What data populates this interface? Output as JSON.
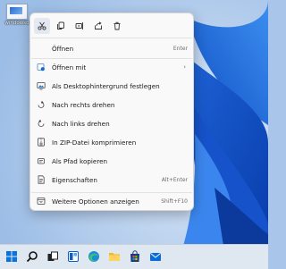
{
  "desktop": {
    "icon_label": "windowsd"
  },
  "toolbar": {
    "icons": [
      "scissors-icon",
      "copy-icon",
      "rename-icon",
      "share-icon",
      "delete-icon"
    ]
  },
  "menu": {
    "items": [
      {
        "label": "Öffnen",
        "shortcut": "Enter",
        "icon": "open-icon"
      },
      {
        "label": "Öffnen mit",
        "shortcut": "",
        "icon": "open-with-icon",
        "submenu": true
      },
      {
        "label": "Als Desktophintergrund festlegen",
        "shortcut": "",
        "icon": "wallpaper-icon"
      },
      {
        "label": "Nach rechts drehen",
        "shortcut": "",
        "icon": "rotate-right-icon"
      },
      {
        "label": "Nach links drehen",
        "shortcut": "",
        "icon": "rotate-left-icon"
      },
      {
        "label": "In ZIP-Datei komprimieren",
        "shortcut": "",
        "icon": "zip-icon"
      },
      {
        "label": "Als Pfad kopieren",
        "shortcut": "",
        "icon": "copy-path-icon"
      },
      {
        "label": "Eigenschaften",
        "shortcut": "Alt+Enter",
        "icon": "properties-icon"
      },
      {
        "label": "Weitere Optionen anzeigen",
        "shortcut": "Shift+F10",
        "icon": "more-options-icon"
      }
    ]
  },
  "taskbar": {
    "apps": [
      "windows-start-icon",
      "search-icon",
      "task-view-icon",
      "widgets-icon",
      "edge-icon",
      "file-explorer-icon",
      "store-icon",
      "mail-icon"
    ]
  },
  "colors": {
    "accent": "#0a6cd8",
    "menu_bg": "#f9f9f9",
    "taskbar_bg": "#dfe7f1"
  }
}
